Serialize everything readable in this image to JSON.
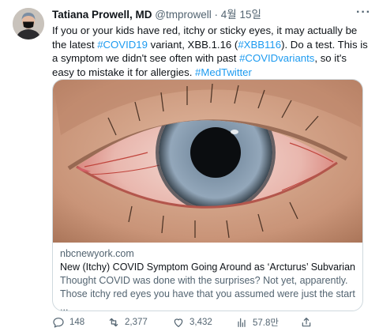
{
  "author": {
    "name": "Tatiana Prowell, MD",
    "handle": "@tmprowell",
    "separator": "·",
    "date": "4월 15일"
  },
  "more_label": "···",
  "tweet_text": {
    "p1": "If you or your kids have red, itchy or sticky eyes, it may actually be the latest ",
    "h1": "#COVID19",
    "p2": " variant, XBB.1.16 (",
    "h2": "#XBB116",
    "p3": "). Do a test. This is a symptom we didn't see often with past ",
    "h3": "#COVIDvariants",
    "p4": ", so it's easy to mistake it for allergies. ",
    "h4": "#MedTwitter"
  },
  "link_card": {
    "domain": "nbcnewyork.com",
    "title": "New (Itchy) COVID Symptom Going Around as ‘Arcturus’ Subvariant ...",
    "description": "Thought COVID was done with the surprises? Not yet, apparently. Those itchy red eyes you have that you assumed were just the start ..."
  },
  "actions": {
    "replies": "148",
    "retweets": "2,377",
    "likes": "3,432",
    "views": "57.8만"
  },
  "colors": {
    "link": "#1d9bf0",
    "secondary_text": "#536471",
    "border": "#cfd9de"
  }
}
